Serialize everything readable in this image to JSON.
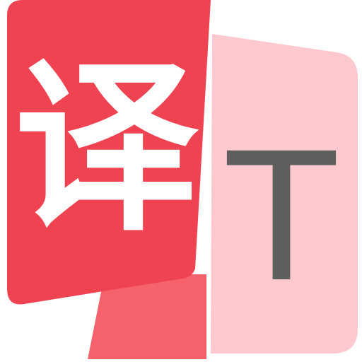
{
  "app_icon": {
    "front_character": "译",
    "back_character": "T",
    "colors": {
      "front_card": "#f04352",
      "back_card": "#fec9ce",
      "tail": "#f6626c",
      "front_character": "#ffffff",
      "back_character": "#5f5f5f",
      "background": "#ffffff"
    },
    "icon_names": [
      "translate-icon"
    ]
  }
}
